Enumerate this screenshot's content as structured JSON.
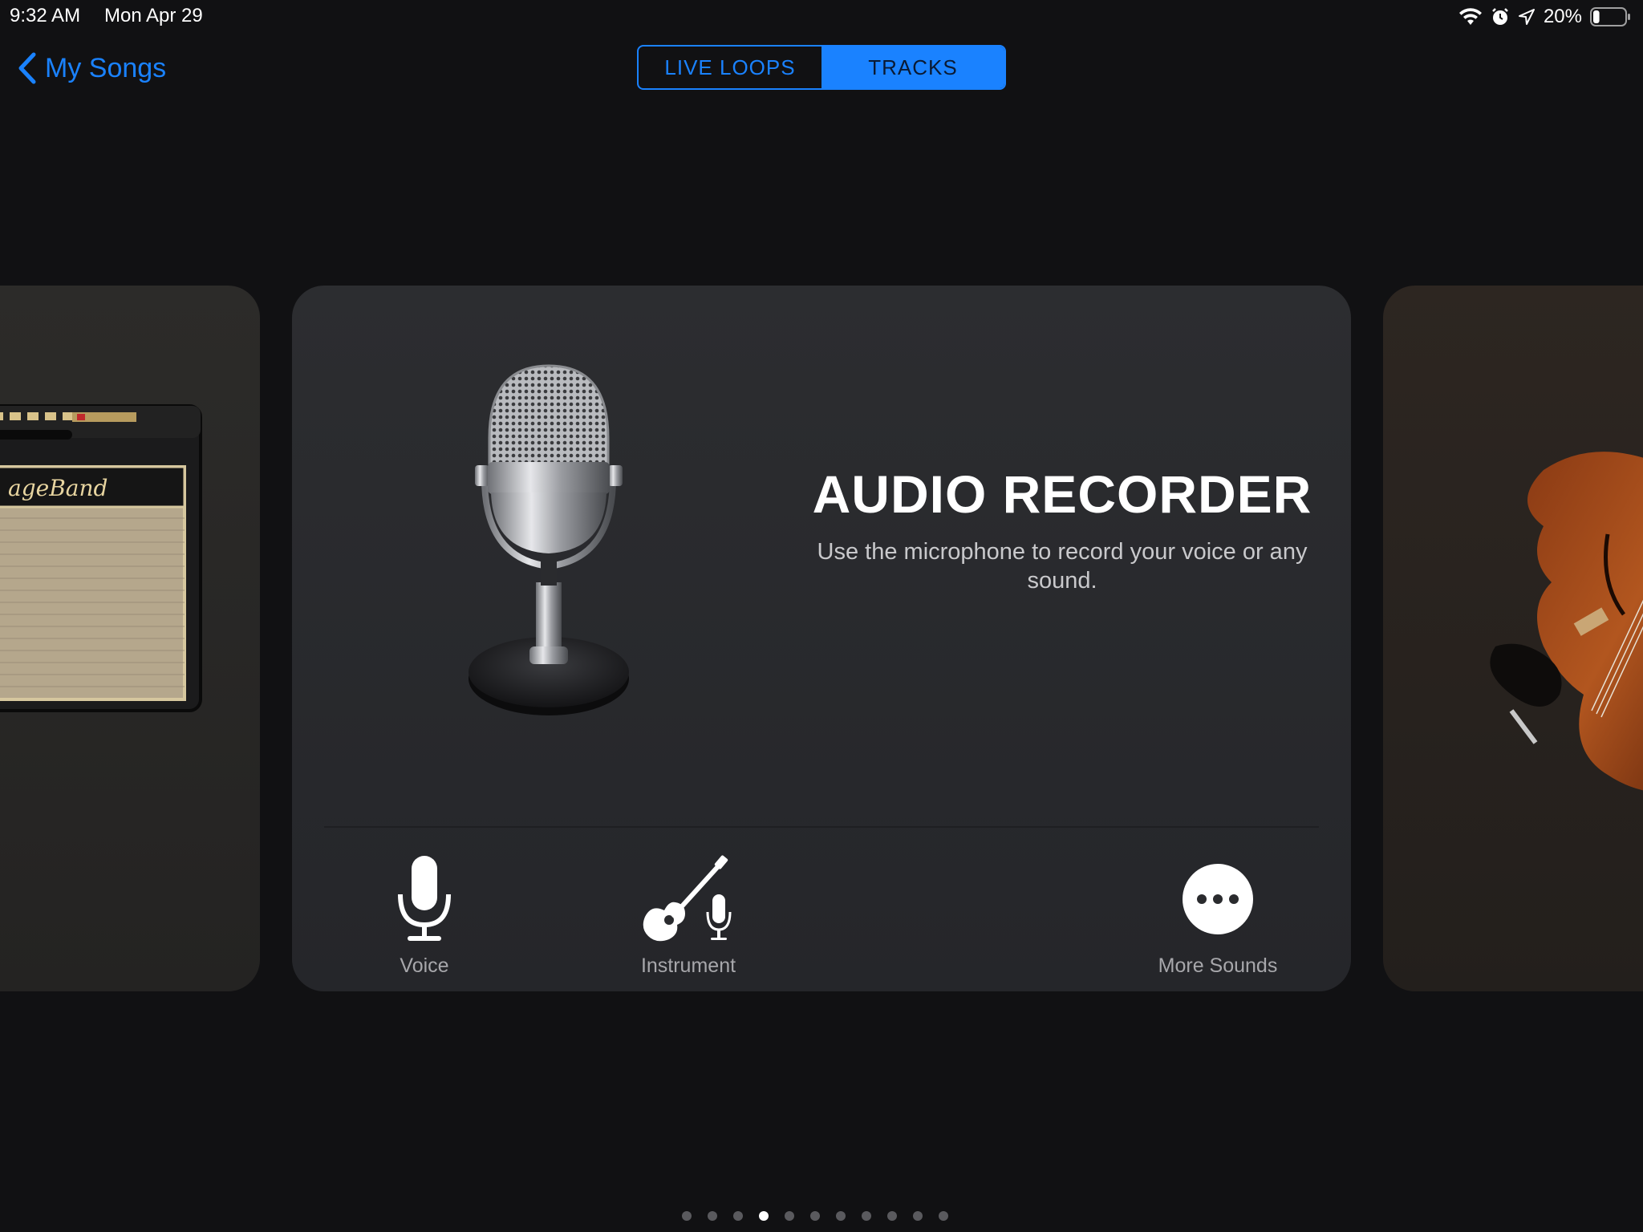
{
  "status_bar": {
    "time": "9:32 AM",
    "date": "Mon Apr 29",
    "battery_percent": "20%",
    "battery_level": 0.2,
    "icons": [
      "wifi-icon",
      "alarm-icon",
      "location-icon",
      "battery-icon"
    ]
  },
  "nav": {
    "back_label": "My Songs",
    "segments": [
      {
        "label": "LIVE LOOPS",
        "active": false
      },
      {
        "label": "TRACKS",
        "active": true
      }
    ]
  },
  "card": {
    "title": "AUDIO RECORDER",
    "description": "Use the microphone to record your voice or any sound.",
    "options": [
      {
        "label": "Voice",
        "icon": "microphone-icon"
      },
      {
        "label": "Instrument",
        "icon": "guitar-mic-icon"
      },
      {
        "label": "More Sounds",
        "icon": "ellipsis-icon"
      }
    ]
  },
  "side_cards": {
    "left_image": "guitar-amp-image",
    "right_image": "violin-image"
  },
  "pagination": {
    "count": 11,
    "active_index": 3
  },
  "colors": {
    "accent": "#1a82ff",
    "background": "#111113",
    "card": "#2a2b2e"
  }
}
